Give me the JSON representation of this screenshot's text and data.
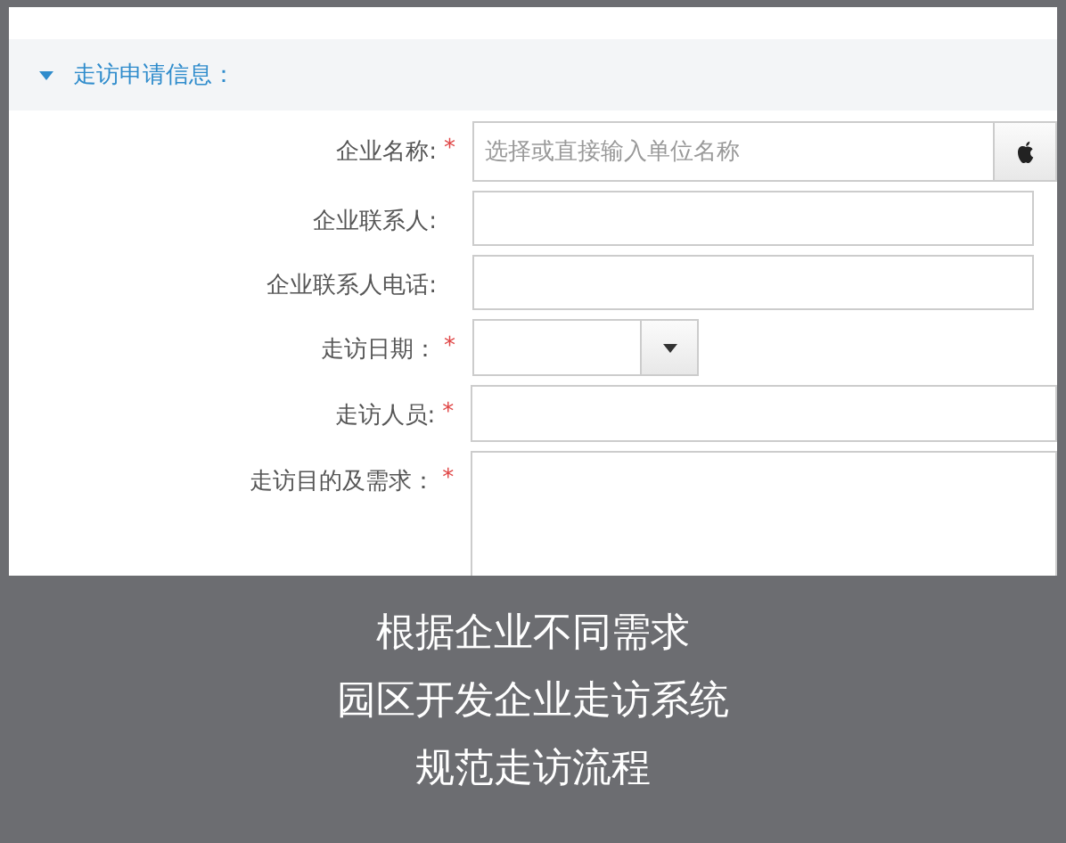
{
  "section": {
    "title": "走访申请信息：",
    "expanded": true
  },
  "fields": [
    {
      "label": "企业名称:",
      "required_mark": "*",
      "kind": "lookup",
      "placeholder": "选择或直接输入单位名称"
    },
    {
      "label": "企业联系人:",
      "kind": "text"
    },
    {
      "label": "企业联系人电话:",
      "kind": "text"
    },
    {
      "label": "走访日期：",
      "required_mark": "*",
      "kind": "date"
    },
    {
      "label": "走访人员:",
      "required_mark": "*",
      "kind": "wide"
    },
    {
      "label": "走访目的及需求：",
      "required_mark": "*",
      "kind": "textarea"
    }
  ],
  "caption": [
    "根据企业不同需求",
    "园区开发企业走访系统",
    "规范走访流程"
  ]
}
